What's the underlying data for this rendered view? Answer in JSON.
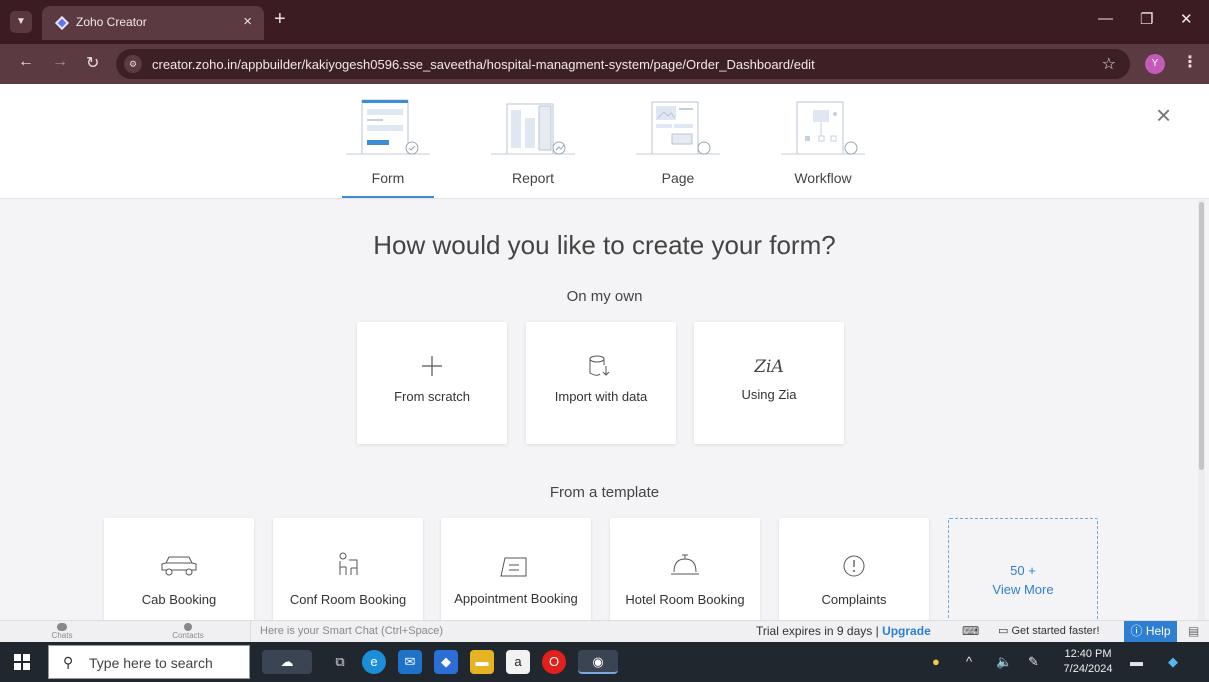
{
  "browser": {
    "tab_title": "Zoho Creator",
    "tab_close": "×",
    "new_tab": "+",
    "url": "creator.zoho.in/appbuilder/kakiyogesh0596.sse_saveetha/hospital-managment-system/page/Order_Dashboard/edit",
    "profile_initial": "Y",
    "icons": [
      "back-icon",
      "forward-icon",
      "reload-icon",
      "star-icon",
      "menu-icon"
    ]
  },
  "types": {
    "items": [
      {
        "label": "Form",
        "active": true
      },
      {
        "label": "Report",
        "active": false
      },
      {
        "label": "Page",
        "active": false
      },
      {
        "label": "Workflow",
        "active": false
      }
    ],
    "close": "×"
  },
  "main": {
    "heading": "How would you like to create your form?",
    "own_title": "On my own",
    "own_cards": [
      {
        "label": "From scratch",
        "icon": "plus-icon"
      },
      {
        "label": "Import with data",
        "icon": "import-icon"
      },
      {
        "label": "Using Zia",
        "icon": "zia-icon"
      }
    ],
    "template_title": "From a template",
    "templates": [
      {
        "label": "Cab Booking",
        "icon": "car-icon"
      },
      {
        "label": "Conf Room Booking",
        "icon": "chair-icon"
      },
      {
        "label": "Appointment Booking",
        "icon": "appointment-icon"
      },
      {
        "label": "Hotel Room Booking",
        "icon": "service-bell-icon"
      },
      {
        "label": "Complaints",
        "icon": "alert-icon"
      }
    ],
    "view_more_count": "50 +",
    "view_more_label": "View More"
  },
  "strip": {
    "chats": "Chats",
    "contacts": "Contacts",
    "smartchat_placeholder": "Here is your Smart Chat (Ctrl+Space)",
    "trial_text": "Trial expires in 9 days | ",
    "upgrade": "Upgrade",
    "get_started": "Get started faster!",
    "help": "Help"
  },
  "taskbar": {
    "search_placeholder": "Type here to search",
    "time": "12:40 PM",
    "date": "7/24/2024"
  },
  "colors": {
    "accent": "#3c8cd6",
    "tabbar": "#3a1c22",
    "help": "#2f7fd0"
  }
}
